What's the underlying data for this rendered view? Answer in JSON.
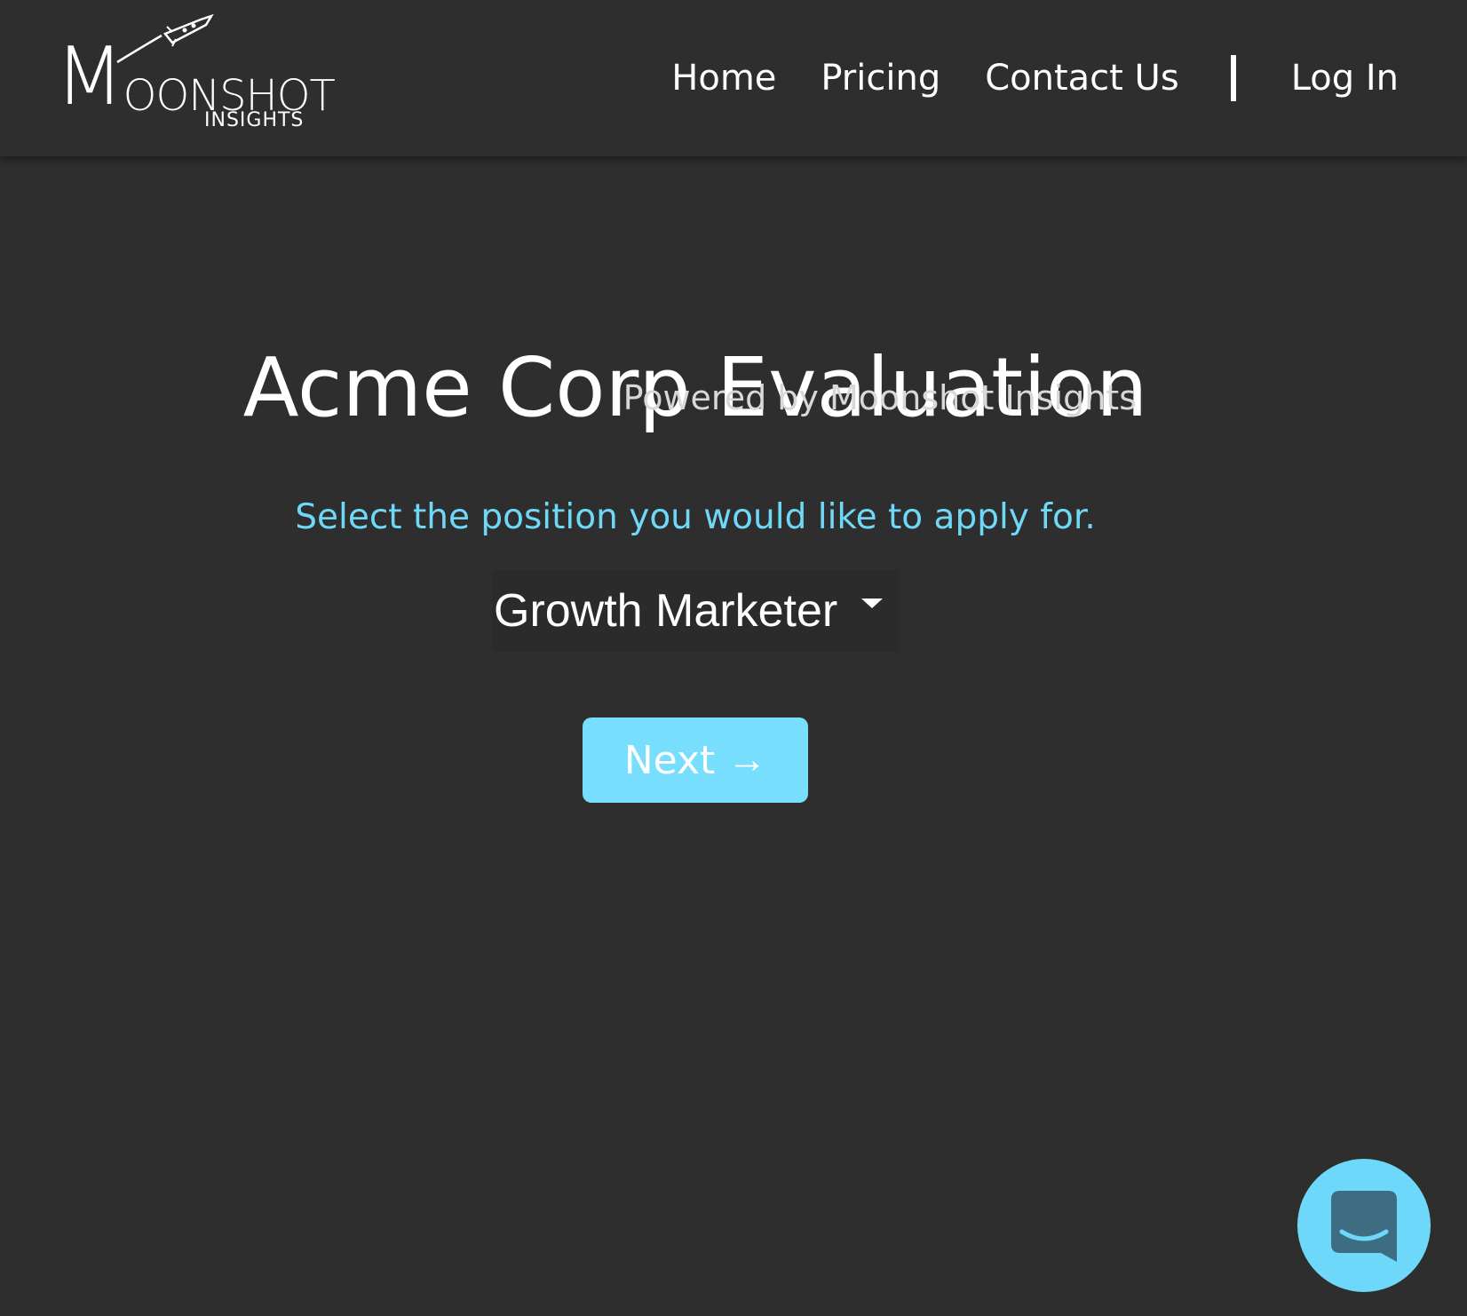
{
  "header": {
    "logo": {
      "main": "MOONSHOT",
      "sub": "INSIGHTS"
    },
    "nav": {
      "home": "Home",
      "pricing": "Pricing",
      "contact": "Contact Us",
      "login": "Log In"
    }
  },
  "main": {
    "title": "Acme Corp Evaluation",
    "powered_by": "Powered by Moonshot Insights",
    "prompt": "Select the position you would like to apply for.",
    "position_select": {
      "selected": "Growth Marketer"
    },
    "next_button": {
      "label": "Next",
      "arrow": "→"
    }
  },
  "chat_widget": {
    "icon": "chat-bubble-icon"
  },
  "colors": {
    "background": "#2e2e2e",
    "accent": "#77defd",
    "prompt_text": "#6fd8f6",
    "chat_icon": "#3e6c80"
  }
}
